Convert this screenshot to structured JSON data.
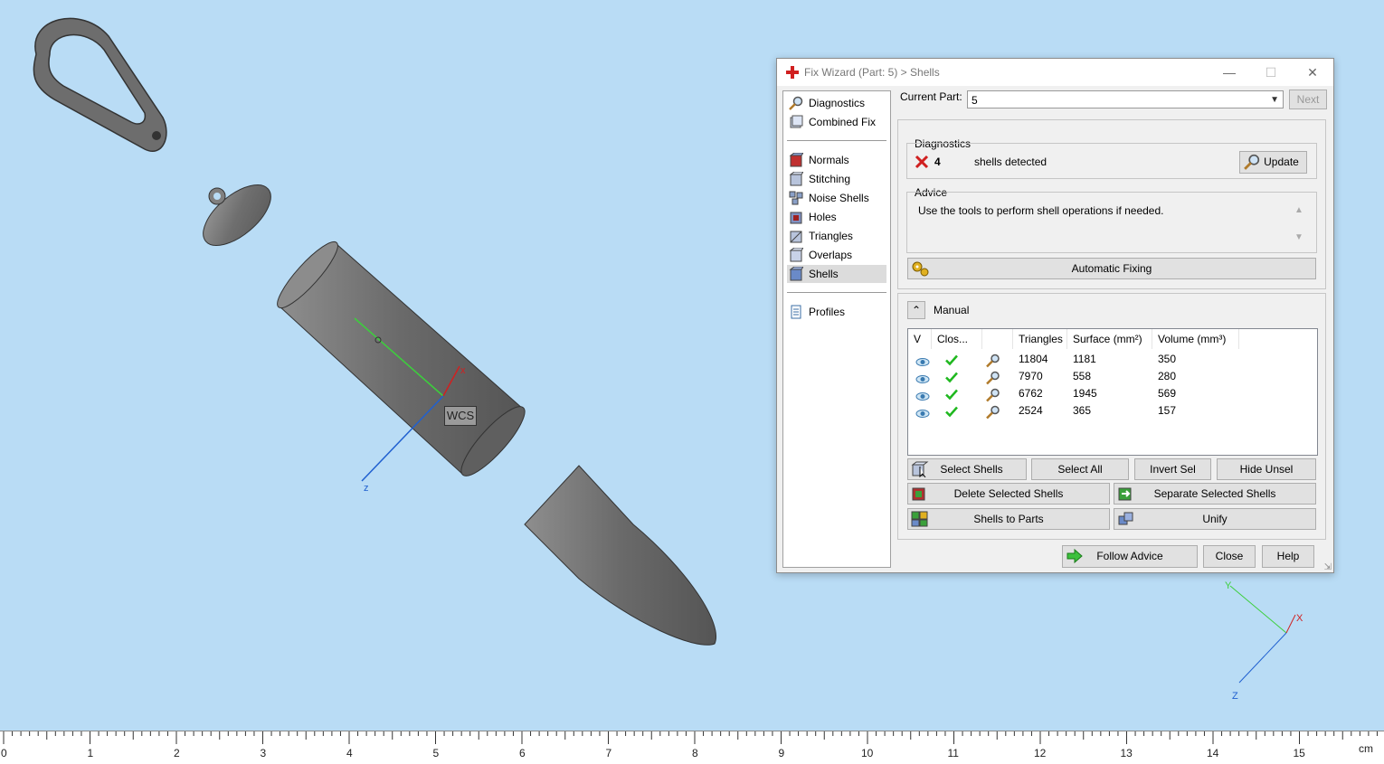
{
  "dialog": {
    "title": "Fix Wizard (Part: 5) > Shells",
    "window_buttons": {
      "minimize": "—",
      "maximize": "☐",
      "close": "✕"
    },
    "nav": {
      "top_items": [
        {
          "label": "Diagnostics",
          "icon": "magnifier-icon"
        },
        {
          "label": "Combined Fix",
          "icon": "combined-fix-icon"
        }
      ],
      "fix_items": [
        {
          "label": "Normals",
          "icon": "normals-icon"
        },
        {
          "label": "Stitching",
          "icon": "stitching-icon"
        },
        {
          "label": "Noise Shells",
          "icon": "noise-shells-icon"
        },
        {
          "label": "Holes",
          "icon": "holes-icon"
        },
        {
          "label": "Triangles",
          "icon": "triangles-icon"
        },
        {
          "label": "Overlaps",
          "icon": "overlaps-icon"
        },
        {
          "label": "Shells",
          "icon": "shells-icon",
          "selected": true
        }
      ],
      "bottom_items": [
        {
          "label": "Profiles",
          "icon": "profiles-icon"
        }
      ]
    },
    "current_part": {
      "label": "Current Part:",
      "value": "5",
      "next_label": "Next"
    },
    "diagnostics": {
      "title": "Diagnostics",
      "count": "4",
      "message": "shells detected",
      "update_label": "Update"
    },
    "advice": {
      "title": "Advice",
      "text": "Use the tools to perform shell operations if needed."
    },
    "automatic_fixing_label": "Automatic Fixing",
    "manual": {
      "title": "Manual",
      "columns": [
        "V",
        "Clos...",
        "",
        "Triangles",
        "Surface (mm²)",
        "Volume (mm³)"
      ],
      "rows": [
        {
          "triangles": "11804",
          "surface": "1181",
          "volume": "350"
        },
        {
          "triangles": "7970",
          "surface": "558",
          "volume": "280"
        },
        {
          "triangles": "6762",
          "surface": "1945",
          "volume": "569"
        },
        {
          "triangles": "2524",
          "surface": "365",
          "volume": "157"
        }
      ],
      "buttons": {
        "select_shells": "Select Shells",
        "select_all": "Select All",
        "invert_sel": "Invert Sel",
        "hide_unsel": "Hide Unsel",
        "delete_selected": "Delete Selected Shells",
        "separate_selected": "Separate Selected Shells",
        "shells_to_parts": "Shells to Parts",
        "unify": "Unify"
      }
    },
    "footer": {
      "follow_advice": "Follow Advice",
      "close": "Close",
      "help": "Help"
    }
  },
  "viewport": {
    "wcs_label": "WCS",
    "wcs_axes": {
      "x": "x",
      "z": "z"
    },
    "corner_axes": {
      "x": "X",
      "y": "Y",
      "z": "Z"
    }
  },
  "ruler": {
    "ticks": [
      "0",
      "1",
      "2",
      "3",
      "4",
      "5",
      "6",
      "7",
      "8",
      "9",
      "10",
      "11",
      "12",
      "13",
      "14",
      "15"
    ],
    "unit": "cm"
  },
  "colors": {
    "background": "#b9dcf5",
    "dialog": "#f0f0f0",
    "check": "#1fb81f",
    "error": "#d02020"
  }
}
